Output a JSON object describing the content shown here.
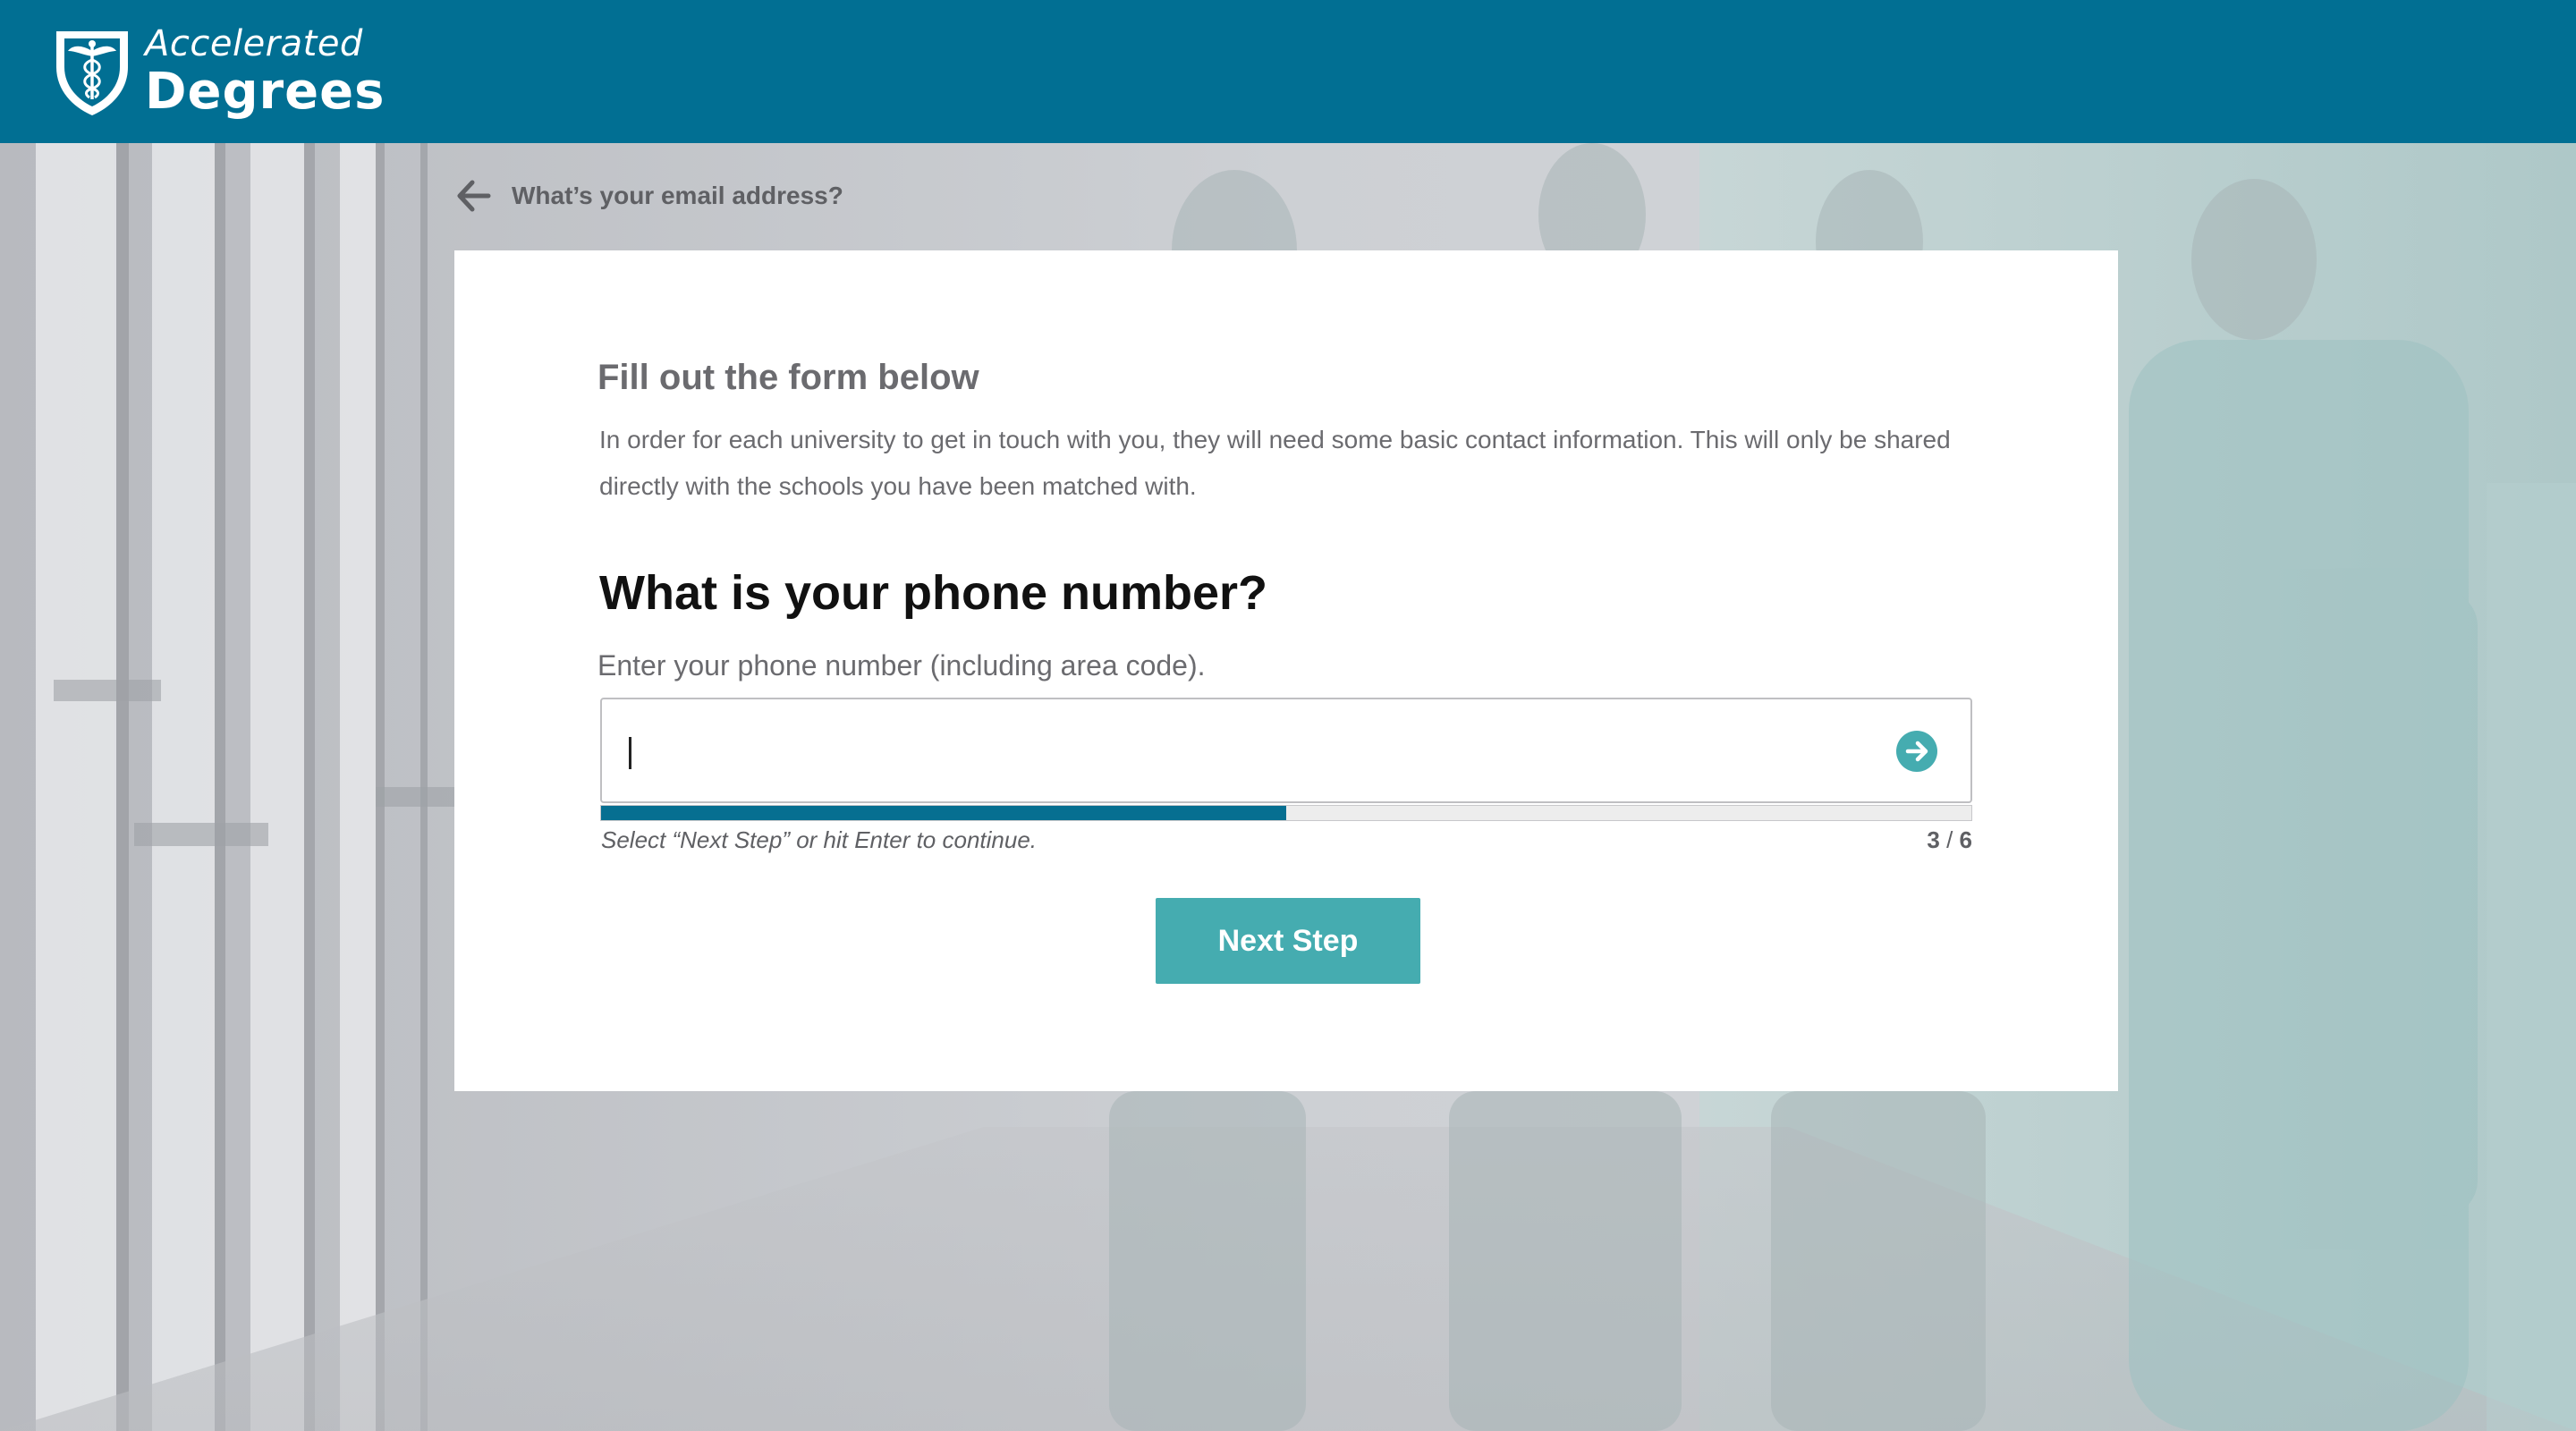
{
  "header": {
    "logo_line1": "Accelerated",
    "logo_line2": "Degrees",
    "background_color": "#016f93"
  },
  "back_link": {
    "icon": "arrow-left-icon",
    "label": "What’s your email address?"
  },
  "form": {
    "intro_title": "Fill out the form below",
    "intro_text": "In order for each university to get in touch with you, they will need some basic contact information. This will only be shared directly with the schools you have been matched with.",
    "question": "What is your phone number?",
    "hint": "Enter your phone number (including area code).",
    "phone_value": "",
    "submit_icon": "arrow-right-circle-icon",
    "continue_hint": "Select “Next Step” or hit Enter to continue.",
    "step_current": "3",
    "step_separator": " / ",
    "step_total": "6",
    "progress_fraction": 0.5,
    "next_button_label": "Next Step"
  },
  "colors": {
    "primary": "#016f93",
    "progress": "#066f91",
    "button": "#45acb0",
    "text_muted": "#6b6b6f"
  }
}
